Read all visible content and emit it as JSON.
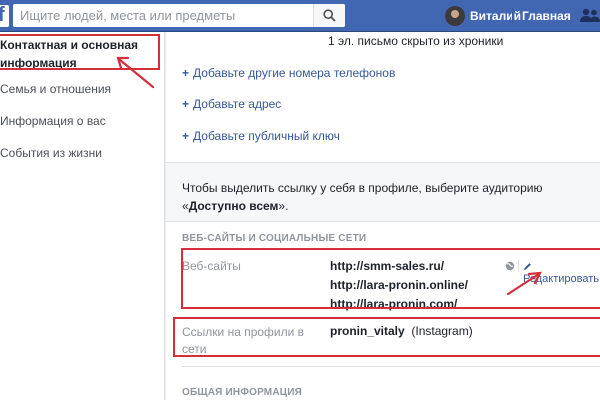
{
  "topbar": {
    "logo_letter": "f",
    "search_placeholder": "Ищите людей, места или предметы",
    "user_name": "Виталий",
    "home_label": "Главная"
  },
  "sidebar": {
    "active_line1": "Контактная и основная",
    "active_line2": "информация",
    "items": [
      {
        "label": "Семья и отношения"
      },
      {
        "label": "Информация о вас"
      },
      {
        "label": "События из жизни"
      }
    ]
  },
  "main": {
    "hidden_email_note": "1 эл. письмо скрыто из хроники",
    "add_links": [
      {
        "label": "Добавьте другие номера телефонов"
      },
      {
        "label": "Добавьте адрес"
      },
      {
        "label": "Добавьте публичный ключ"
      }
    ],
    "plus_sign": "+",
    "audience_note_part1": "Чтобы выделить ссылку у себя в профиле, выберите аудиторию «",
    "audience_note_bold": "Доступно всем",
    "audience_note_part2": "».",
    "websites_section_title": "ВЕБ-САЙТЫ И СОЦИАЛЬНЫЕ СЕТИ",
    "websites_label": "Веб-сайты",
    "websites": [
      {
        "url": "http://smm-sales.ru/"
      },
      {
        "url": "http://lara-pronin.online/"
      },
      {
        "url": "http://lara-pronin.com/"
      }
    ],
    "edit_label": "Редактировать",
    "profiles_label_line1": "Ссылки на профили в",
    "profiles_label_line2": "сети",
    "profile_handle": "pronin_vitaly",
    "profile_network": "(Instagram)",
    "general_section_title": "ОБЩАЯ ИНФОРМАЦИЯ"
  },
  "colors": {
    "brand_blue": "#4267b2",
    "link_blue": "#365899",
    "annotation_red": "#d32f3a"
  }
}
